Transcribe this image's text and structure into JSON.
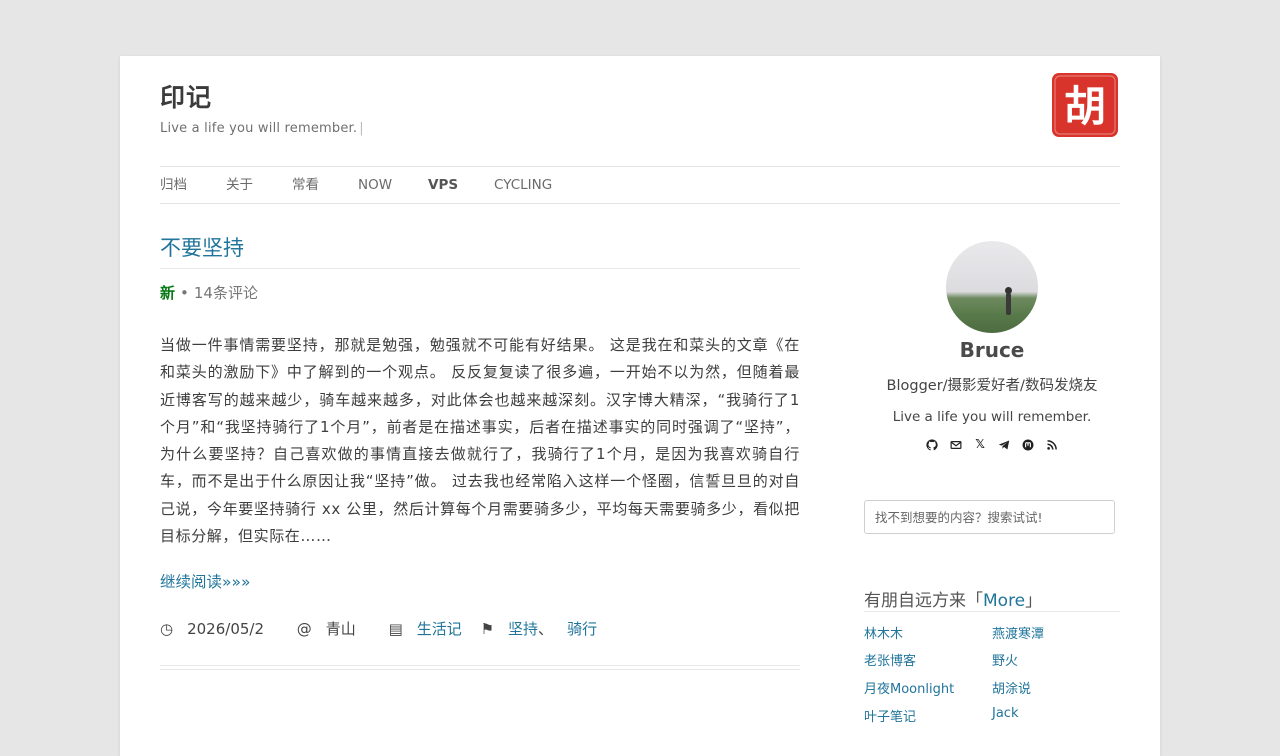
{
  "header": {
    "site_title": "印记",
    "site_description": "Live a life you will remember.",
    "cursor_mark": "|",
    "seal_char": "胡"
  },
  "nav": {
    "items": [
      {
        "label": "归档"
      },
      {
        "label": "关于"
      },
      {
        "label": "常看"
      },
      {
        "label": "NOW"
      },
      {
        "label": "VPS"
      },
      {
        "label": "CYCLING"
      }
    ],
    "active": "VPS"
  },
  "post": {
    "title": "不要坚持",
    "badge_new": "新",
    "meta_separator": "•",
    "comments": "14条评论",
    "excerpt": "当做一件事情需要坚持，那就是勉强，勉强就不可能有好结果。 这是我在和菜头的文章《在和菜头的激励下》中了解到的一个观点。 反反复复读了很多遍，一开始不以为然，但随着最近博客写的越来越少，骑车越来越多，对此体会也越来越深刻。汉字博大精深，“我骑行了1个月”和“我坚持骑行了1个月”，前者是在描述事实，后者在描述事实的同时强调了“坚持”，为什么要坚持？自己喜欢做的事情直接去做就行了，我骑行了1个月，是因为我喜欢骑自行车，而不是出于什么原因让我“坚持”做。 过去我也经常陷入这样一个怪圈，信誓旦旦的对自己说，今年要坚持骑行 xx 公里，然后计算每个月需要骑多少，平均每天需要骑多少，看似把目标分解，但实际在……",
    "read_more": "继续阅读»»»",
    "date_icon": "◷",
    "date": "2026/05/2",
    "location_prefix": "@",
    "location": "青山",
    "category_icon": "▤",
    "category": "生活记",
    "tags_icon": "⚑",
    "tags": [
      "坚持",
      "骑行"
    ],
    "tag_separator": "、"
  },
  "sidebar": {
    "profile": {
      "name": "Bruce",
      "bio": "Blogger/摄影爱好者/数码发烧友",
      "motto": "Live a life you will remember.",
      "social_icons": [
        "github-icon",
        "email-icon",
        "x-icon",
        "telegram-icon",
        "mastodon-icon",
        "rss-icon"
      ],
      "x_glyph": "𝕏"
    },
    "search": {
      "placeholder": "找不到想要的内容？搜索试试!"
    },
    "friends": {
      "title_prefix": "有朋自远方来「",
      "more_label": "More",
      "title_suffix": "」",
      "links": [
        "林木木",
        "燕渡寒潭",
        "老张博客",
        "野火",
        "月夜Moonlight",
        "胡涂说",
        "叶子笔记",
        "Jack"
      ]
    }
  },
  "colors": {
    "link": "#21759b",
    "new_badge": "#0a7a17",
    "seal": "#d9342b",
    "background": "#e6e6e6"
  }
}
